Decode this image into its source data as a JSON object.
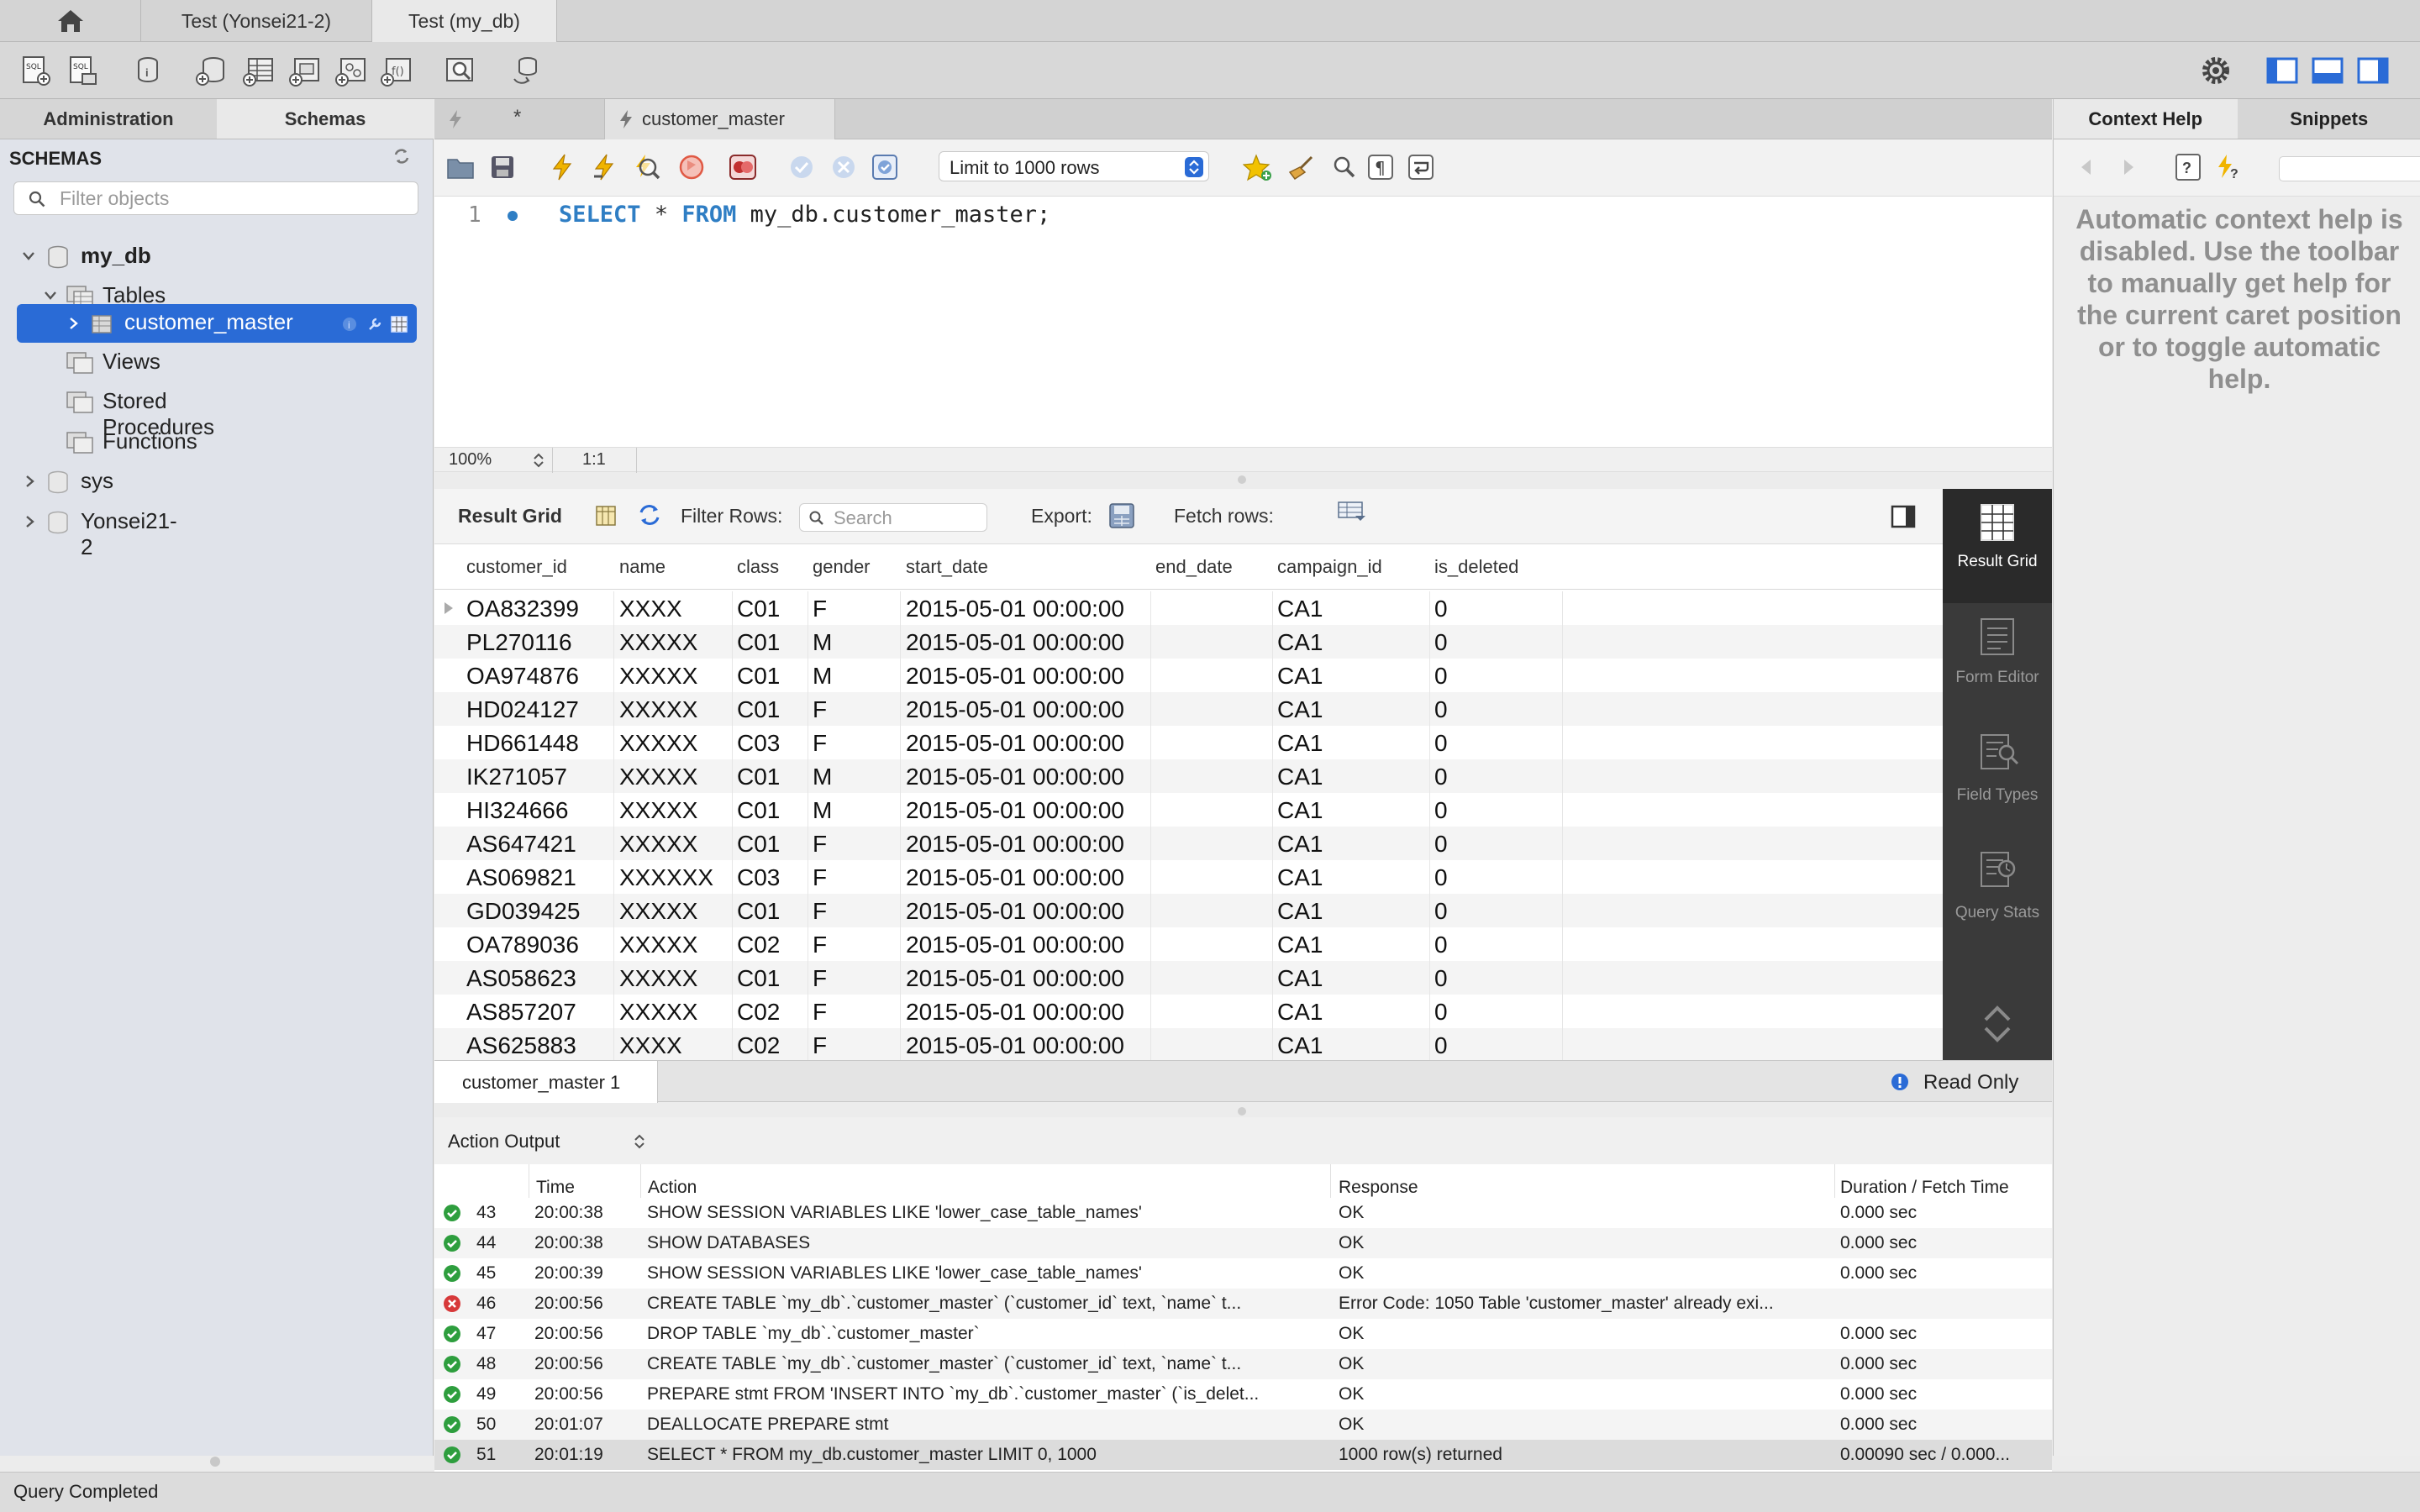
{
  "tabs": {
    "home_icon": "home-icon",
    "connections": [
      {
        "label": "Test (Yonsei21-2)",
        "active": false
      },
      {
        "label": "Test (my_db)",
        "active": true
      }
    ]
  },
  "sidebar": {
    "tabs": [
      "Administration",
      "Schemas"
    ],
    "active_tab": "Schemas",
    "header": "SCHEMAS",
    "filter_placeholder": "Filter objects",
    "tree": {
      "db1": "my_db",
      "tables": "Tables",
      "selected_table": "customer_master",
      "views": "Views",
      "procedures": "Stored Procedures",
      "functions": "Functions",
      "db2": "sys",
      "db3": "Yonsei21-2"
    }
  },
  "editor": {
    "tab_unsaved": "*",
    "tab_label": "customer_master",
    "limit_label": "Limit to 1000 rows",
    "line_number": "1",
    "sql": {
      "kw1": "SELECT",
      "star": "*",
      "kw2": "FROM",
      "rest": "my_db.customer_master;"
    },
    "zoom": "100%",
    "cursor": "1:1"
  },
  "results": {
    "toolbar": {
      "result_grid": "Result Grid",
      "filter_rows": "Filter Rows:",
      "search_placeholder": "Search",
      "export": "Export:",
      "fetch_rows": "Fetch rows:"
    },
    "columns": [
      "customer_id",
      "name",
      "class",
      "gender",
      "start_date",
      "end_date",
      "campaign_id",
      "is_deleted"
    ],
    "rows": [
      [
        "OA832399",
        "XXXX",
        "C01",
        "F",
        "2015-05-01 00:00:00",
        "",
        "CA1",
        "0"
      ],
      [
        "PL270116",
        "XXXXX",
        "C01",
        "M",
        "2015-05-01 00:00:00",
        "",
        "CA1",
        "0"
      ],
      [
        "OA974876",
        "XXXXX",
        "C01",
        "M",
        "2015-05-01 00:00:00",
        "",
        "CA1",
        "0"
      ],
      [
        "HD024127",
        "XXXXX",
        "C01",
        "F",
        "2015-05-01 00:00:00",
        "",
        "CA1",
        "0"
      ],
      [
        "HD661448",
        "XXXXX",
        "C03",
        "F",
        "2015-05-01 00:00:00",
        "",
        "CA1",
        "0"
      ],
      [
        "IK271057",
        "XXXXX",
        "C01",
        "M",
        "2015-05-01 00:00:00",
        "",
        "CA1",
        "0"
      ],
      [
        "HI324666",
        "XXXXX",
        "C01",
        "M",
        "2015-05-01 00:00:00",
        "",
        "CA1",
        "0"
      ],
      [
        "AS647421",
        "XXXXX",
        "C01",
        "F",
        "2015-05-01 00:00:00",
        "",
        "CA1",
        "0"
      ],
      [
        "AS069821",
        "XXXXXX",
        "C03",
        "F",
        "2015-05-01 00:00:00",
        "",
        "CA1",
        "0"
      ],
      [
        "GD039425",
        "XXXXX",
        "C01",
        "F",
        "2015-05-01 00:00:00",
        "",
        "CA1",
        "0"
      ],
      [
        "OA789036",
        "XXXXX",
        "C02",
        "F",
        "2015-05-01 00:00:00",
        "",
        "CA1",
        "0"
      ],
      [
        "AS058623",
        "XXXXX",
        "C01",
        "F",
        "2015-05-01 00:00:00",
        "",
        "CA1",
        "0"
      ],
      [
        "AS857207",
        "XXXXX",
        "C02",
        "F",
        "2015-05-01 00:00:00",
        "",
        "CA1",
        "0"
      ],
      [
        "AS625883",
        "XXXX",
        "C02",
        "F",
        "2015-05-01 00:00:00",
        "",
        "CA1",
        "0"
      ]
    ],
    "side_panel": [
      "Result Grid",
      "Form Editor",
      "Field Types",
      "Query Stats"
    ],
    "result_tab": "customer_master 1",
    "read_only": "Read Only"
  },
  "output": {
    "selector": "Action Output",
    "columns": [
      "Time",
      "Action",
      "Response",
      "Duration / Fetch Time"
    ],
    "rows": [
      {
        "status": "ok",
        "n": "43",
        "time": "20:00:38",
        "action": "SHOW SESSION VARIABLES LIKE 'lower_case_table_names'",
        "response": "OK",
        "duration": "0.000 sec"
      },
      {
        "status": "ok",
        "n": "44",
        "time": "20:00:38",
        "action": "SHOW DATABASES",
        "response": "OK",
        "duration": "0.000 sec"
      },
      {
        "status": "ok",
        "n": "45",
        "time": "20:00:39",
        "action": "SHOW SESSION VARIABLES LIKE 'lower_case_table_names'",
        "response": "OK",
        "duration": "0.000 sec"
      },
      {
        "status": "error",
        "n": "46",
        "time": "20:00:56",
        "action": "CREATE TABLE `my_db`.`customer_master` (`customer_id` text, `name` t...",
        "response": "Error Code: 1050 Table 'customer_master' already exi...",
        "duration": ""
      },
      {
        "status": "ok",
        "n": "47",
        "time": "20:00:56",
        "action": "DROP TABLE `my_db`.`customer_master`",
        "response": "OK",
        "duration": "0.000 sec"
      },
      {
        "status": "ok",
        "n": "48",
        "time": "20:00:56",
        "action": "CREATE TABLE `my_db`.`customer_master` (`customer_id` text, `name` t...",
        "response": "OK",
        "duration": "0.000 sec"
      },
      {
        "status": "ok",
        "n": "49",
        "time": "20:00:56",
        "action": "PREPARE stmt FROM 'INSERT INTO `my_db`.`customer_master` (`is_delet...",
        "response": "OK",
        "duration": "0.000 sec"
      },
      {
        "status": "ok",
        "n": "50",
        "time": "20:01:07",
        "action": "DEALLOCATE PREPARE stmt",
        "response": "OK",
        "duration": "0.000 sec"
      },
      {
        "status": "ok",
        "n": "51",
        "time": "20:01:19",
        "action": "SELECT * FROM my_db.customer_master LIMIT 0, 1000",
        "response": "1000 row(s) returned",
        "duration": "0.00090 sec / 0.000..."
      }
    ]
  },
  "help": {
    "tabs": [
      "Context Help",
      "Snippets"
    ],
    "active_tab": "Context Help",
    "message": "Automatic context help is disabled. Use the toolbar to manually get help for the current caret position or to toggle automatic help."
  },
  "status": {
    "text": "Query Completed"
  },
  "colors": {
    "accent": "#2a6bd6",
    "keyword": "#2f7ec4",
    "ok": "#2e9e3e",
    "error": "#d7393a"
  }
}
